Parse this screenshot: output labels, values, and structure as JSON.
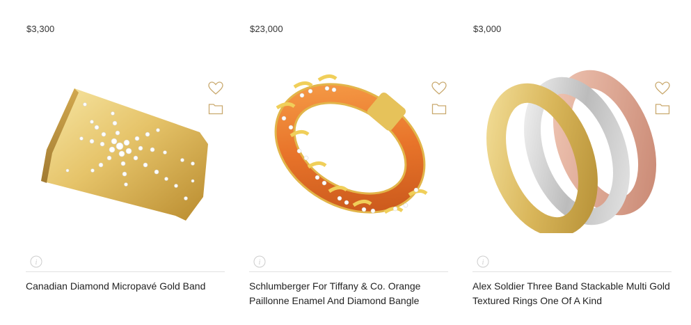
{
  "products": [
    {
      "price": "$3,300",
      "title": "Canadian Diamond Micropavé Gold Band",
      "image": "gold-diamond-cuff"
    },
    {
      "price": "$23,000",
      "title": "Schlumberger For Tiffany & Co. Orange Paillonne Enamel And Diamond Bangle",
      "image": "orange-enamel-bangle"
    },
    {
      "price": "$3,000",
      "title": "Alex Soldier Three Band Stackable Multi Gold Textured Rings One Of A Kind",
      "image": "three-band-rings"
    }
  ],
  "icons": {
    "favorite": "heart-icon",
    "save": "folder-icon",
    "info": "info-icon"
  },
  "colors": {
    "accent": "#c9a96e",
    "text": "#222222",
    "divider": "#e1e1e1",
    "info_icon": "#cccccc"
  }
}
